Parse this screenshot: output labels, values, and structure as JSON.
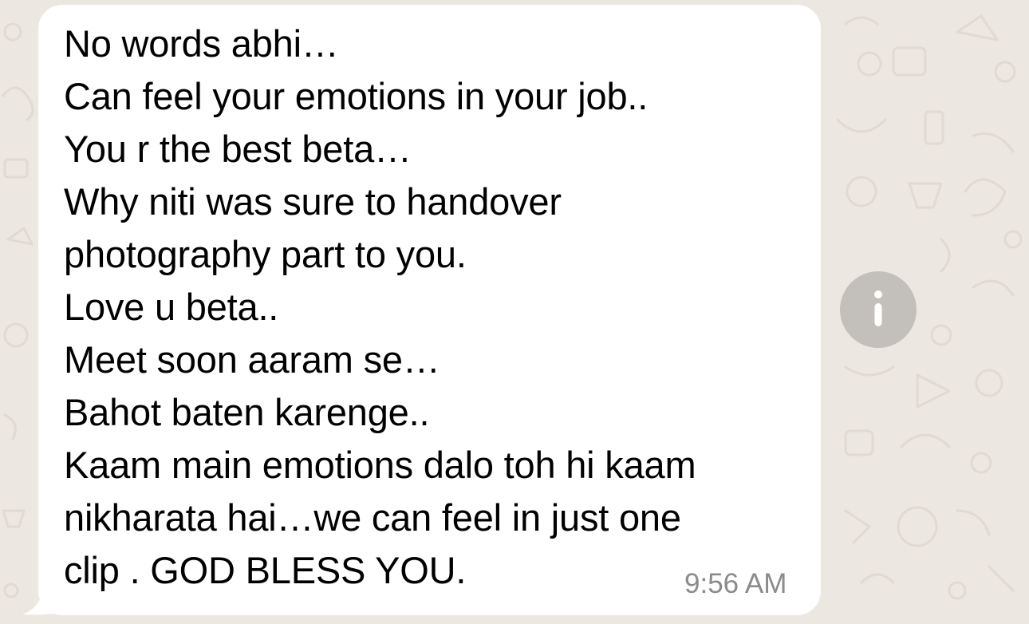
{
  "conversation": {
    "message": {
      "lines": [
        "No words abhi…",
        "Can feel your emotions in your job..",
        "You r the best beta…",
        "Why niti was sure to handover",
        "photography part to you.",
        "Love u beta..",
        "Meet soon aaram se…",
        "Bahot baten karenge..",
        "Kaam main emotions dalo toh hi kaam",
        "nikharata hai…we can feel in just one",
        "clip . GOD BLESS YOU."
      ],
      "timestamp": "9:56 AM"
    },
    "info_icon": "info-icon"
  },
  "colors": {
    "background": "#ece7e0",
    "bubble": "#ffffff",
    "text": "#000000",
    "timestamp": "#8b8b8b",
    "info_button": "#c3c0bb"
  }
}
